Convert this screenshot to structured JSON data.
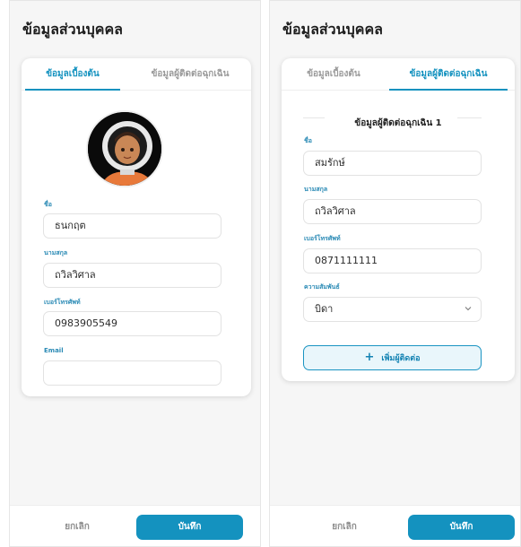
{
  "page_title": "ข้อมูลส่วนบุคคล",
  "tabs": {
    "basic": "ข้อมูลเบื้องต้น",
    "emergency": "ข้อมูลผู้ติดต่อฉุกเฉิน"
  },
  "basic_form": {
    "first_name_label": "ชื่อ",
    "first_name": "ธนกฤต",
    "last_name_label": "นามสกุล",
    "last_name": "ถวิลวิศาล",
    "phone_label": "เบอร์โทรศัพท์",
    "phone": "0983905549",
    "email_label": "Email",
    "email": ""
  },
  "emergency_form": {
    "section_title": "ข้อมูลผู้ติดต่อฉุกเฉิน 1",
    "first_name_label": "ชื่อ",
    "first_name": "สมรักษ์",
    "last_name_label": "นามสกุล",
    "last_name": "ถวิลวิศาล",
    "phone_label": "เบอร์โทรศัพท์",
    "phone": "0871111111",
    "relation_label": "ความสัมพันธ์",
    "relation": "บิดา",
    "add_contact_label": "เพิ่มผู้ติดต่อ"
  },
  "footer": {
    "cancel": "ยกเลิก",
    "save": "บันทึก"
  },
  "colors": {
    "primary": "#1492bf",
    "label": "#2a8ab5",
    "add_bg": "#e9f6fb"
  },
  "icons": [
    "avatar-photo",
    "plus-icon",
    "chevron-down-icon"
  ]
}
